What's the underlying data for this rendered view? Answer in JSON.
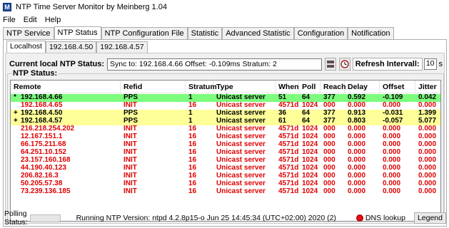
{
  "window": {
    "title": "NTP Time Server Monitor by Meinberg 1.04"
  },
  "menu": [
    "File",
    "Edit",
    "Help"
  ],
  "main_tabs": [
    "NTP Service",
    "NTP Status",
    "NTP Configuration File",
    "Statistic",
    "Advanced Statistic",
    "Configuration",
    "Notification"
  ],
  "host_tabs": [
    "Localhost",
    "192.168.4.50",
    "192.168.4.57"
  ],
  "status": {
    "label": "Current local NTP Status:",
    "value": "Sync to: 192.168.4.66   Offset: -0.109ms   Stratum: 2"
  },
  "refresh": {
    "label": "Refresh Intervall:",
    "value": "10",
    "unit": "s"
  },
  "group_label": "NTP Status:",
  "columns": [
    "Remote",
    "Refid",
    "Stratum",
    "Type",
    "When",
    "Poll",
    "Reach",
    "Delay",
    "Offset",
    "Jitter"
  ],
  "rows": [
    {
      "flag": "*",
      "remote": "192.168.4.66",
      "refid": "PPS",
      "stratum": "1",
      "type": "Unicast server",
      "when": "51",
      "poll": "64",
      "reach": "377",
      "delay": "0.592",
      "offset": "-0.109",
      "jitter": "0.042",
      "style": "green"
    },
    {
      "flag": "",
      "remote": "192.168.4.65",
      "refid": "INIT",
      "stratum": "16",
      "type": "Unicast server",
      "when": "4571d",
      "poll": "1024",
      "reach": "000",
      "delay": "0.000",
      "offset": "0.000",
      "jitter": "0.000",
      "style": "red"
    },
    {
      "flag": "+",
      "remote": "192.168.4.50",
      "refid": "PPS",
      "stratum": "1",
      "type": "Unicast server",
      "when": "36",
      "poll": "64",
      "reach": "377",
      "delay": "0.913",
      "offset": "-0.031",
      "jitter": "1.399",
      "style": "yellow"
    },
    {
      "flag": "+",
      "remote": "192.168.4.57",
      "refid": "PPS",
      "stratum": "1",
      "type": "Unicast server",
      "when": "61",
      "poll": "64",
      "reach": "377",
      "delay": "0.803",
      "offset": "-0.057",
      "jitter": "5.077",
      "style": "yellow"
    },
    {
      "flag": "",
      "remote": "216.218.254.202",
      "refid": "INIT",
      "stratum": "16",
      "type": "Unicast server",
      "when": "4571d",
      "poll": "1024",
      "reach": "000",
      "delay": "0.000",
      "offset": "0.000",
      "jitter": "0.000",
      "style": "red"
    },
    {
      "flag": "",
      "remote": "12.167.151.1",
      "refid": "INIT",
      "stratum": "16",
      "type": "Unicast server",
      "when": "4571d",
      "poll": "1024",
      "reach": "000",
      "delay": "0.000",
      "offset": "0.000",
      "jitter": "0.000",
      "style": "red"
    },
    {
      "flag": "",
      "remote": "66.175.211.68",
      "refid": "INIT",
      "stratum": "16",
      "type": "Unicast server",
      "when": "4571d",
      "poll": "1024",
      "reach": "000",
      "delay": "0.000",
      "offset": "0.000",
      "jitter": "0.000",
      "style": "red"
    },
    {
      "flag": "",
      "remote": "64.251.10.152",
      "refid": "INIT",
      "stratum": "16",
      "type": "Unicast server",
      "when": "4571d",
      "poll": "1024",
      "reach": "000",
      "delay": "0.000",
      "offset": "0.000",
      "jitter": "0.000",
      "style": "red"
    },
    {
      "flag": "",
      "remote": "23.157.160.168",
      "refid": "INIT",
      "stratum": "16",
      "type": "Unicast server",
      "when": "4571d",
      "poll": "1024",
      "reach": "000",
      "delay": "0.000",
      "offset": "0.000",
      "jitter": "0.000",
      "style": "red"
    },
    {
      "flag": "",
      "remote": "44.190.40.123",
      "refid": "INIT",
      "stratum": "16",
      "type": "Unicast server",
      "when": "4571d",
      "poll": "1024",
      "reach": "000",
      "delay": "0.000",
      "offset": "0.000",
      "jitter": "0.000",
      "style": "red"
    },
    {
      "flag": "",
      "remote": "206.82.16.3",
      "refid": "INIT",
      "stratum": "16",
      "type": "Unicast server",
      "when": "4571d",
      "poll": "1024",
      "reach": "000",
      "delay": "0.000",
      "offset": "0.000",
      "jitter": "0.000",
      "style": "red"
    },
    {
      "flag": "",
      "remote": "50.205.57.38",
      "refid": "INIT",
      "stratum": "16",
      "type": "Unicast server",
      "when": "4571d",
      "poll": "1024",
      "reach": "000",
      "delay": "0.000",
      "offset": "0.000",
      "jitter": "0.000",
      "style": "red"
    },
    {
      "flag": "",
      "remote": "73.239.136.185",
      "refid": "INIT",
      "stratum": "16",
      "type": "Unicast server",
      "when": "4571d",
      "poll": "1024",
      "reach": "000",
      "delay": "0.000",
      "offset": "0.000",
      "jitter": "0.000",
      "style": "red"
    }
  ],
  "colors": {
    "ok_text": "#000000",
    "error_text": "#e00000",
    "sync_row": "#7dfc7d",
    "candidate_row": "#ffff99"
  },
  "footer": {
    "polling_label": "Polling Status:",
    "version": "Running NTP Version: ntpd 4.2.8p15-o Jun 25 14:45:34 (UTC+02:00) 2020  (2)",
    "dns_label": "DNS lookup",
    "legend_label": "Legend"
  }
}
